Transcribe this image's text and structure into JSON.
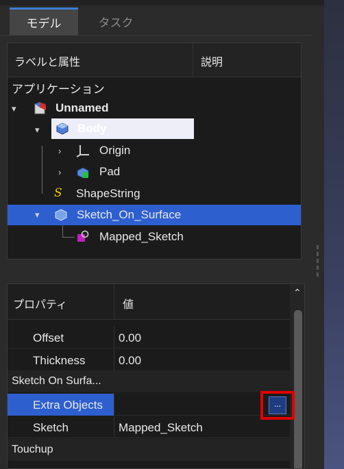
{
  "tabs": [
    {
      "label": "モデル",
      "active": true
    },
    {
      "label": "タスク",
      "active": false
    }
  ],
  "tree": {
    "headers": {
      "label": "ラベルと属性",
      "description": "説明"
    },
    "root_label": "アプリケーション",
    "items": {
      "unnamed": "Unnamed",
      "body": "Body",
      "origin": "Origin",
      "pad": "Pad",
      "shapestring": "ShapeString",
      "sketch_on_surface": "Sketch_On_Surface",
      "mapped_sketch": "Mapped_Sketch"
    }
  },
  "properties": {
    "headers": {
      "property": "プロパティ",
      "value": "値"
    },
    "rows": {
      "offset": {
        "key": "Offset",
        "value": "0.00"
      },
      "thickness": {
        "key": "Thickness",
        "value": "0.00"
      },
      "group_sketch": "Sketch On Surfa...",
      "extra_objects": {
        "key": "Extra Objects",
        "value": ""
      },
      "sketch": {
        "key": "Sketch",
        "value": "Mapped_Sketch"
      },
      "group_touchup": "Touchup"
    },
    "ellipsis_button": "..."
  },
  "colors": {
    "selection": "#2e5fcf",
    "highlight_red": "#e00000"
  }
}
